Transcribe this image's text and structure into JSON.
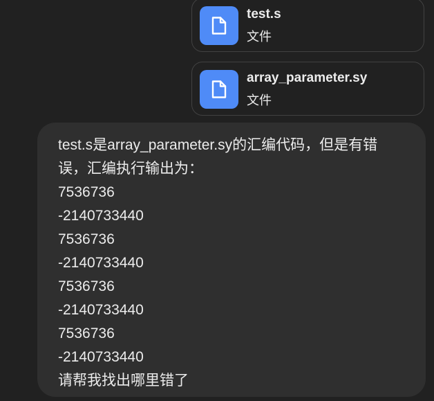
{
  "attachments": [
    {
      "name": "test.s",
      "type": "文件",
      "icon": "file-icon"
    },
    {
      "name": "array_parameter.sy",
      "type": "文件",
      "icon": "file-icon"
    }
  ],
  "message": {
    "lines": [
      "test.s是array_parameter.sy的汇编代码，但是有错",
      "误，汇编执行输出为：",
      "7536736",
      "-2140733440",
      "7536736",
      "-2140733440",
      "7536736",
      "-2140733440",
      "7536736",
      "-2140733440",
      "请帮我找出哪里错了"
    ]
  },
  "colors": {
    "background": "#212121",
    "bubble": "#2f2f2f",
    "file_icon_accent": "#4f8bf7",
    "text": "#ececec"
  }
}
